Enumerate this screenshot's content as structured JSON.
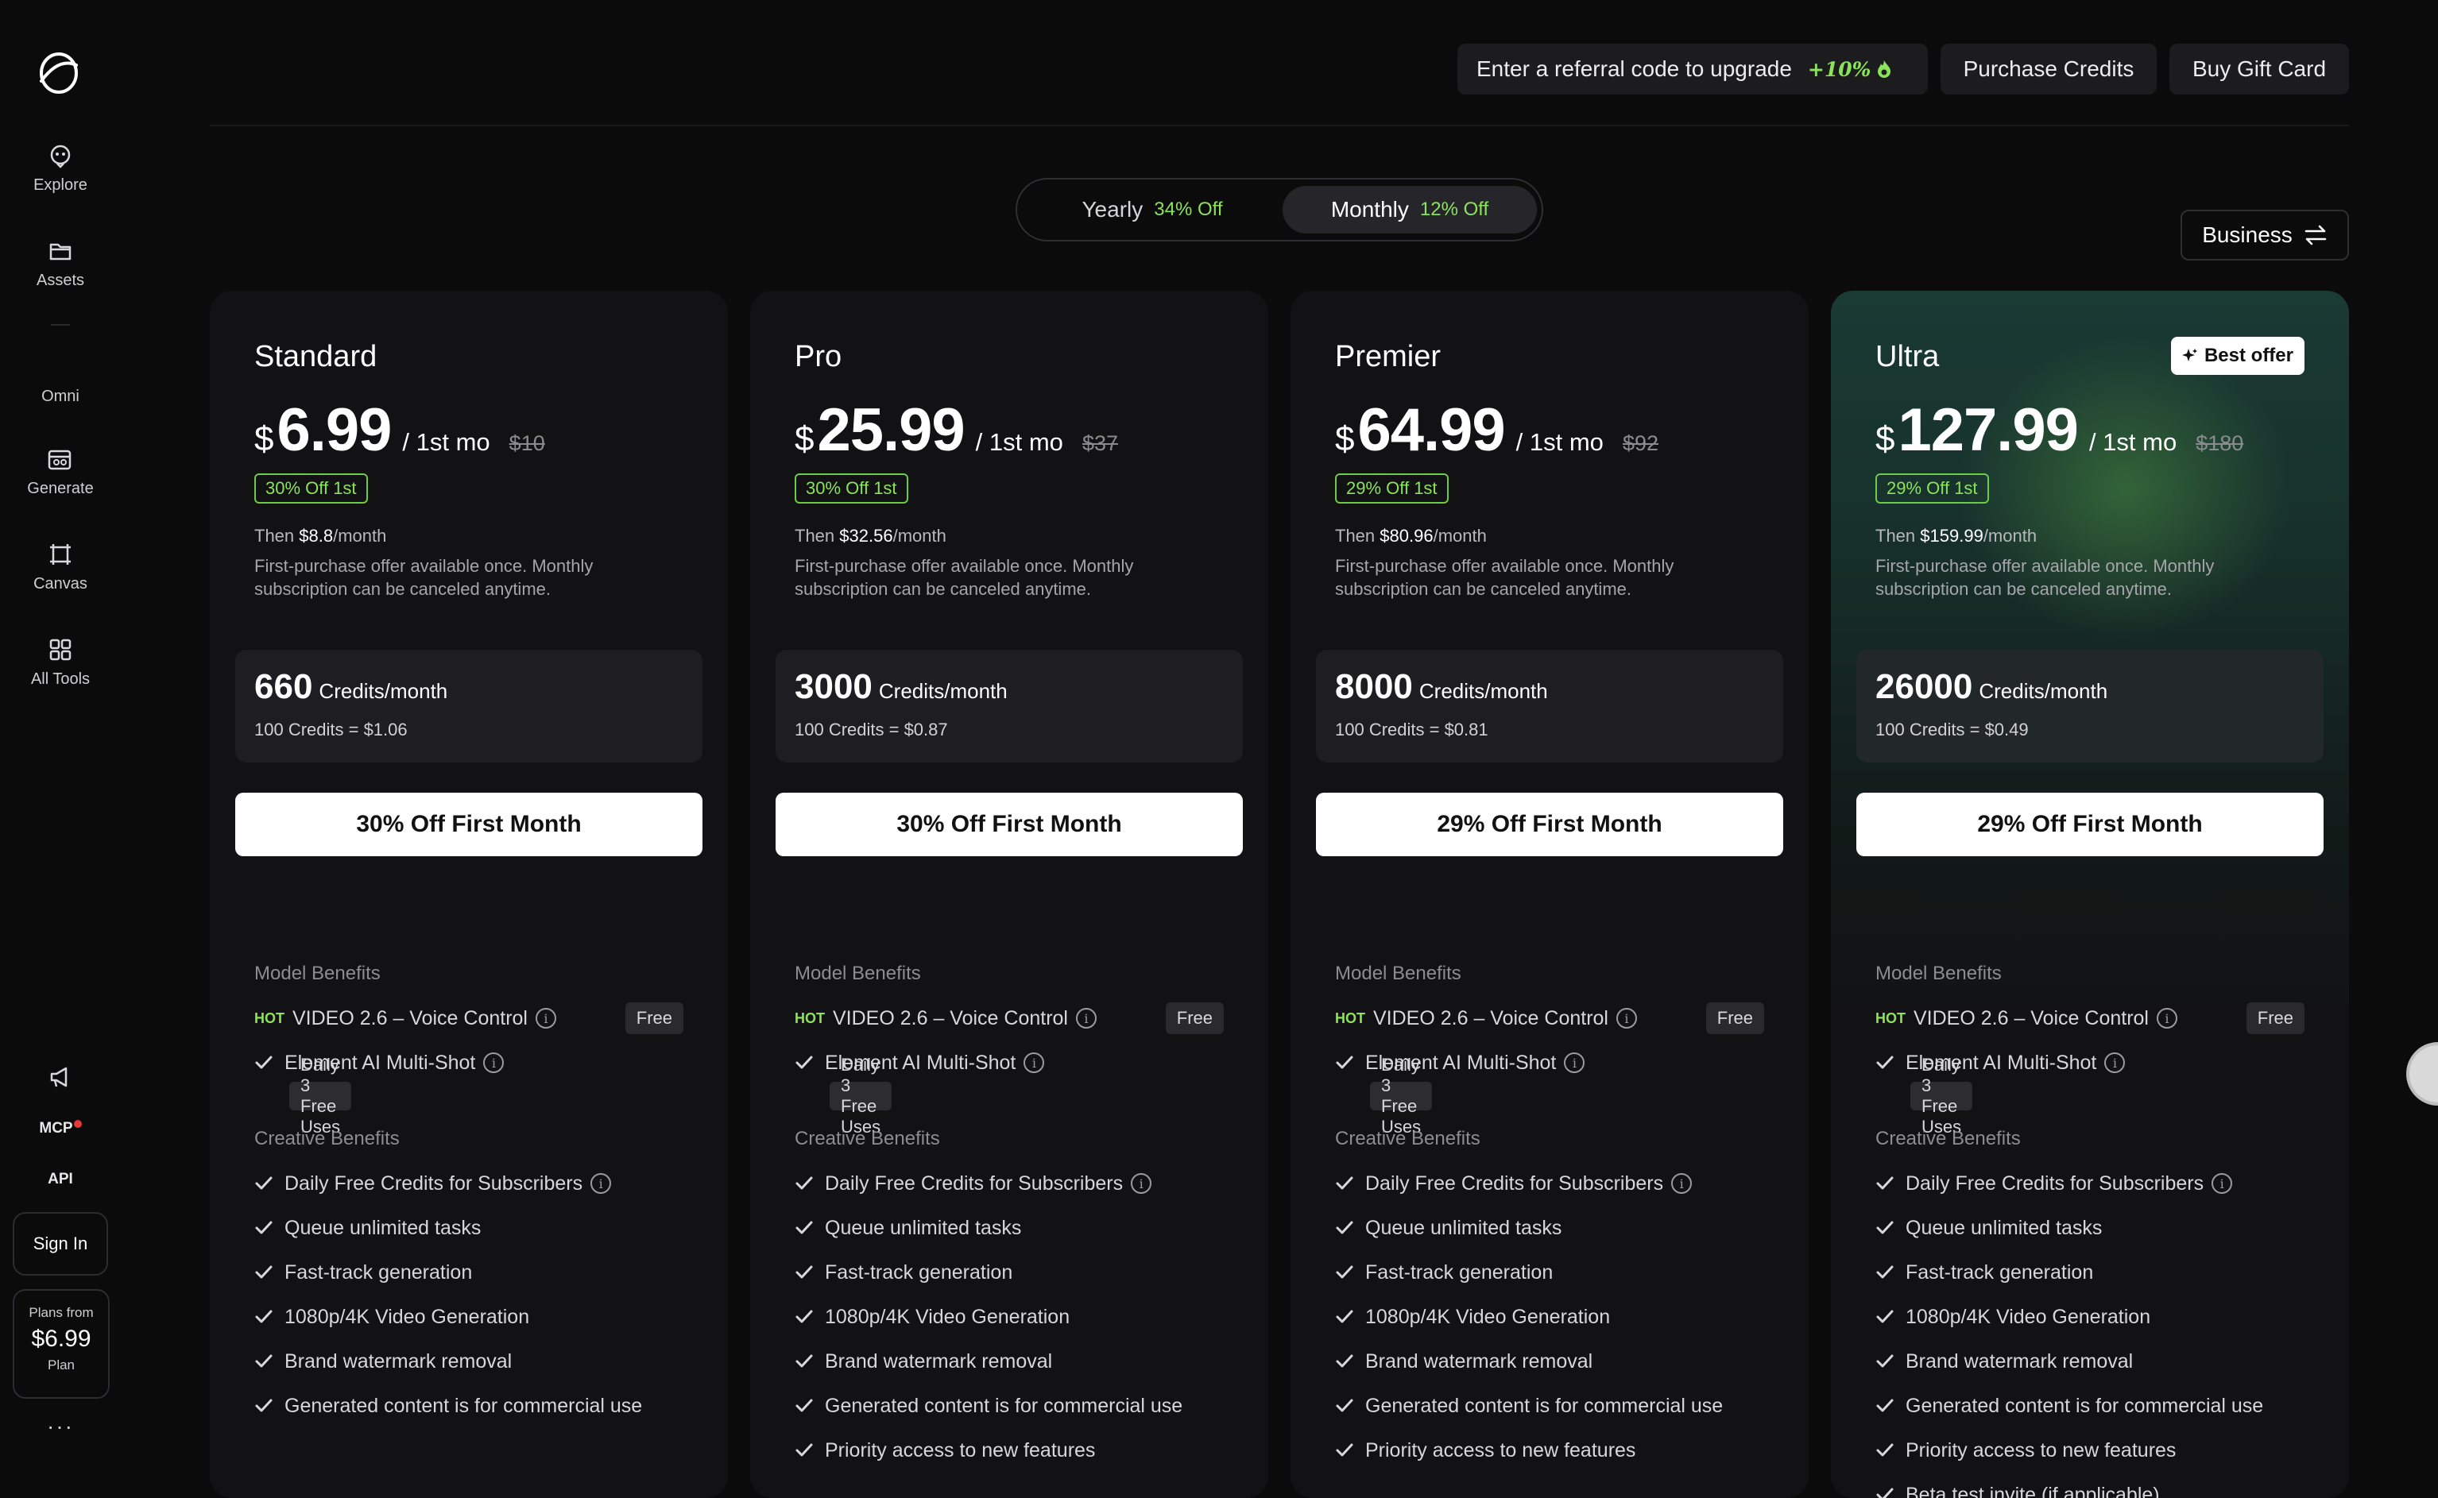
{
  "sidebar": {
    "items": [
      {
        "label": "Explore",
        "icon": "explore-icon"
      },
      {
        "label": "Assets",
        "icon": "folder-icon"
      },
      {
        "label": "Omni",
        "icon": ""
      },
      {
        "label": "Generate",
        "icon": "generate-icon"
      },
      {
        "label": "Canvas",
        "icon": "canvas-icon"
      },
      {
        "label": "All Tools",
        "icon": "grid-icon"
      }
    ],
    "mcp_label": "MCP",
    "api_label": "API",
    "sign_in": "Sign In",
    "plans_from": "Plans from",
    "plans_price": "$6.99",
    "plans_suffix": "Plan",
    "more": "···"
  },
  "header": {
    "referral_text": "Enter a referral code to upgrade",
    "referral_bonus": "+10%",
    "purchase_credits": "Purchase Credits",
    "buy_gift_card": "Buy Gift Card"
  },
  "billing": {
    "yearly_label": "Yearly",
    "yearly_off": "34% Off",
    "monthly_label": "Monthly",
    "monthly_off": "12% Off",
    "selected": "Monthly"
  },
  "business_label": "Business",
  "plans": [
    {
      "name": "Standard",
      "currency": "$",
      "price": "6.99",
      "period": "/ 1st mo",
      "original": "$10",
      "discount_tag": "30% Off 1st",
      "then_prefix": "Then",
      "then_price": "$8.8",
      "then_suffix": "/month",
      "note": "First-purchase offer available once. Monthly subscription can be canceled anytime.",
      "credits": "660",
      "credits_unit": "Credits/month",
      "credits_rate": "100 Credits = $1.06",
      "cta": "30% Off First Month"
    },
    {
      "name": "Pro",
      "currency": "$",
      "price": "25.99",
      "period": "/ 1st mo",
      "original": "$37",
      "discount_tag": "30% Off 1st",
      "then_prefix": "Then",
      "then_price": "$32.56",
      "then_suffix": "/month",
      "note": "First-purchase offer available once. Monthly subscription can be canceled anytime.",
      "credits": "3000",
      "credits_unit": "Credits/month",
      "credits_rate": "100 Credits = $0.87",
      "cta": "30% Off First Month"
    },
    {
      "name": "Premier",
      "currency": "$",
      "price": "64.99",
      "period": "/ 1st mo",
      "original": "$92",
      "discount_tag": "29% Off 1st",
      "then_prefix": "Then",
      "then_price": "$80.96",
      "then_suffix": "/month",
      "note": "First-purchase offer available once. Monthly subscription can be canceled anytime.",
      "credits": "8000",
      "credits_unit": "Credits/month",
      "credits_rate": "100 Credits = $0.81",
      "cta": "29% Off First Month"
    },
    {
      "name": "Ultra",
      "currency": "$",
      "price": "127.99",
      "period": "/ 1st mo",
      "original": "$180",
      "discount_tag": "29% Off 1st",
      "then_prefix": "Then",
      "then_price": "$159.99",
      "then_suffix": "/month",
      "note": "First-purchase offer available once. Monthly subscription can be canceled anytime.",
      "credits": "26000",
      "credits_unit": "Credits/month",
      "credits_rate": "100 Credits = $0.49",
      "cta": "29% Off First Month",
      "badge": "Best offer"
    }
  ],
  "benefits": {
    "model_label": "Model Benefits",
    "hot": "HOT",
    "video_feature": "VIDEO 2.6 – Voice Control",
    "free_badge": "Free",
    "multishot": "Element AI Multi-Shot",
    "daily_badge": "Daily 3 Free Uses",
    "creative_label": "Creative Benefits",
    "creative": [
      "Daily Free Credits for Subscribers",
      "Queue unlimited tasks",
      "Fast-track generation",
      "1080p/4K Video Generation",
      "Brand watermark removal",
      "Generated content is for commercial use"
    ],
    "priority": "Priority access to new features",
    "beta": "Beta test invite (if applicable)"
  },
  "colors": {
    "accent": "#8be35a",
    "background": "#0b0b0c",
    "card": "#121214"
  }
}
